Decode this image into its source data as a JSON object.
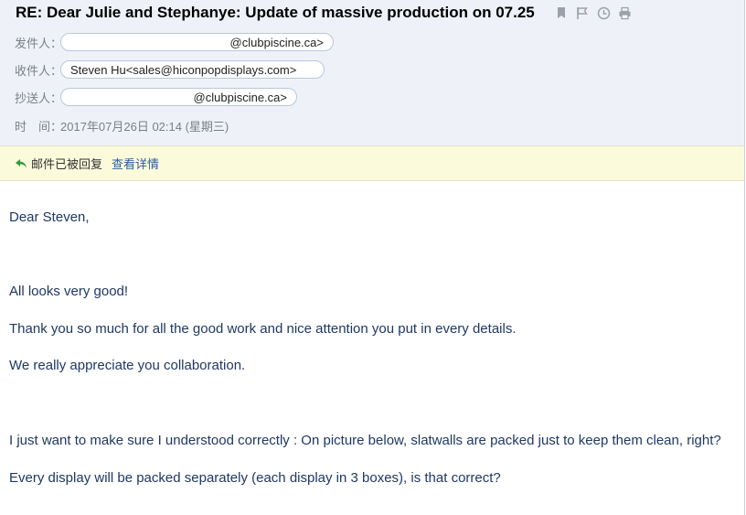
{
  "subject": "RE: Dear Julie and Stephanye: Update of massive production on 07.25",
  "toolbar": {
    "icons": [
      "bookmark-icon",
      "flag-icon",
      "clock-icon",
      "print-icon"
    ]
  },
  "from": {
    "label": "发件人：",
    "value": "@clubpiscine.ca>"
  },
  "to": {
    "label": "收件人：",
    "name": "Steven Hu",
    "email": "<sales@hiconpopdisplays.com>"
  },
  "cc": {
    "label": "抄送人：",
    "value": "@clubpiscine.ca>"
  },
  "time": {
    "label": "时　间：",
    "value": "2017年07月26日 02:14 (星期三)"
  },
  "reply_bar": {
    "text": "邮件已被回复",
    "link": "查看详情"
  },
  "body": {
    "greeting": "Dear Steven,",
    "line1": "All looks very good!",
    "line2": "Thank you so much for all the good work and nice attention you put in every details.",
    "line3": "We really appreciate you collaboration.",
    "line4": "I just want to make sure I understood correctly : On picture below, slatwalls are packed just to keep them clean, right?",
    "line5": "Every display will be packed separately (each display in 3 boxes), is that correct?"
  },
  "colors": {
    "header_bg": "#eef2f8",
    "reply_bg": "#fbfbdc",
    "body_text": "#1f3864",
    "link": "#2a5d9f",
    "reply_icon": "#3a9a3a"
  }
}
